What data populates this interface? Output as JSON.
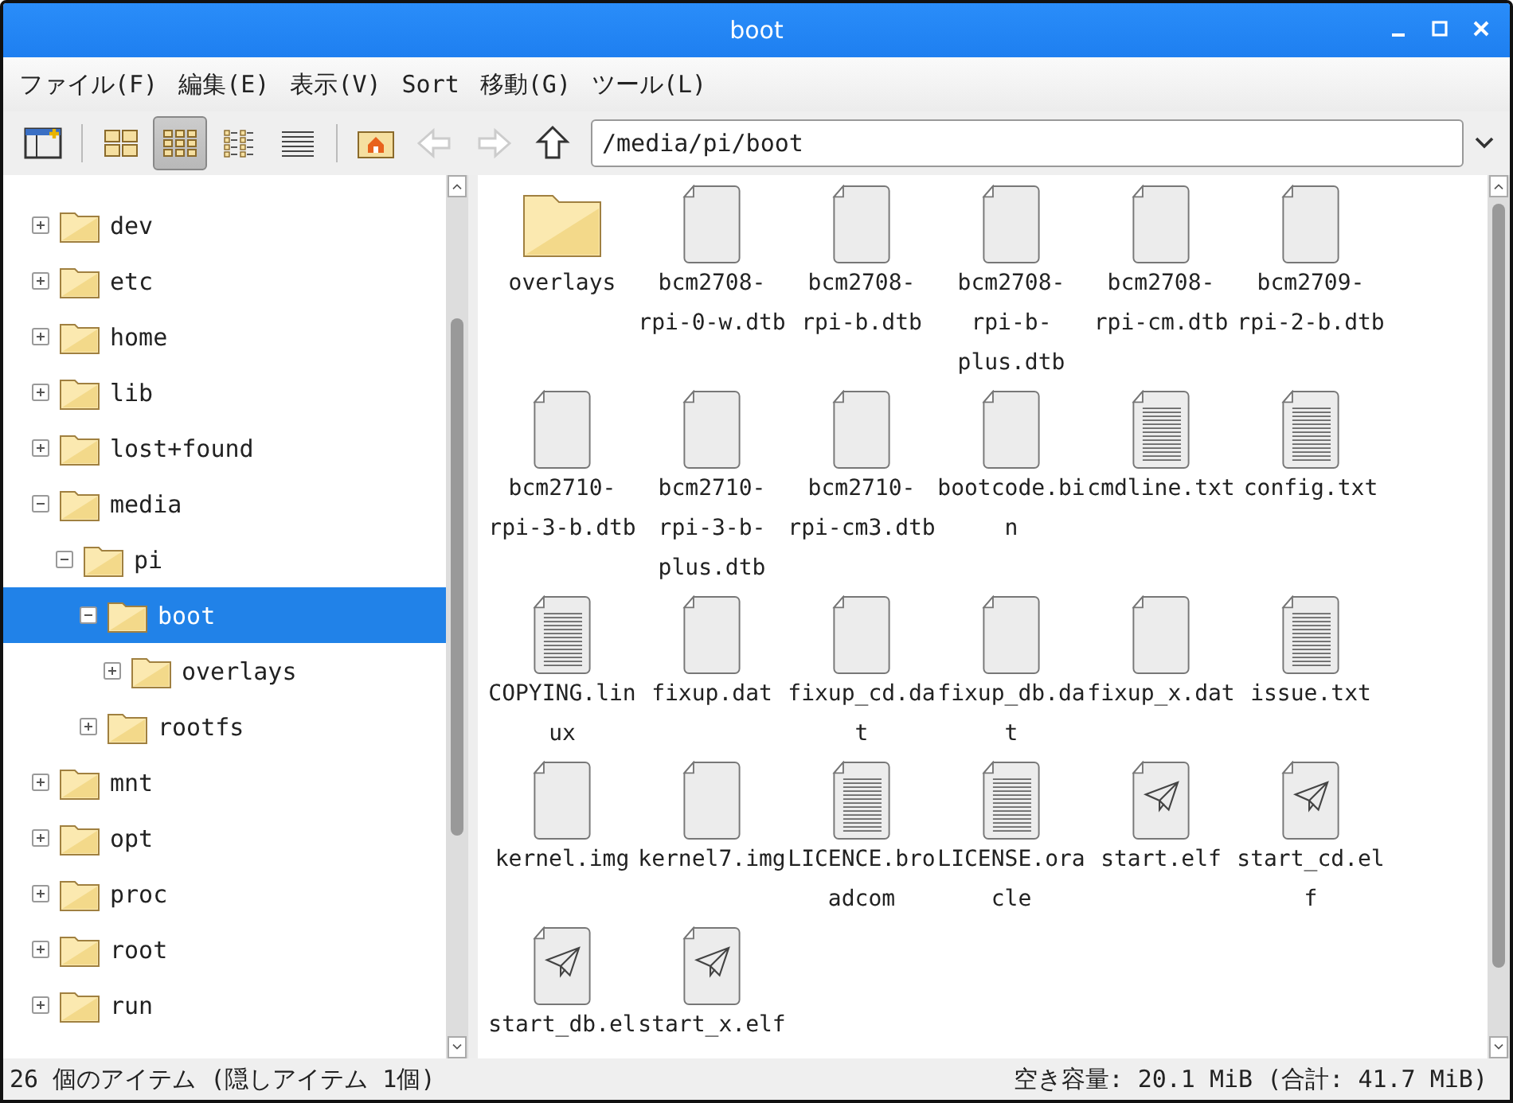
{
  "window": {
    "title": "boot"
  },
  "menu": [
    "ファイル(F)",
    "編集(E)",
    "表示(V)",
    "Sort",
    "移動(G)",
    "ツール(L)"
  ],
  "toolbar": {
    "views": [
      {
        "kind": "thumb",
        "selected": false
      },
      {
        "kind": "icons",
        "selected": true
      },
      {
        "kind": "compact",
        "selected": false
      },
      {
        "kind": "list",
        "selected": false
      }
    ],
    "back_disabled": true,
    "forward_disabled": true,
    "path": "/media/pi/boot"
  },
  "tree": [
    {
      "name": "dev",
      "expanded": false
    },
    {
      "name": "etc",
      "expanded": false
    },
    {
      "name": "home",
      "expanded": false
    },
    {
      "name": "lib",
      "expanded": false
    },
    {
      "name": "lost+found",
      "expanded": false
    },
    {
      "name": "media",
      "expanded": true,
      "children": [
        {
          "name": "pi",
          "expanded": true,
          "children": [
            {
              "name": "boot",
              "expanded": true,
              "selected": true,
              "children": [
                {
                  "name": "overlays",
                  "expanded": false
                }
              ]
            },
            {
              "name": "rootfs",
              "expanded": false
            }
          ]
        }
      ]
    },
    {
      "name": "mnt",
      "expanded": false
    },
    {
      "name": "opt",
      "expanded": false
    },
    {
      "name": "proc",
      "expanded": false
    },
    {
      "name": "root",
      "expanded": false
    },
    {
      "name": "run",
      "expanded": false
    }
  ],
  "files": [
    {
      "name": "overlays",
      "kind": "folder"
    },
    {
      "name": "bcm2708-rpi-0-w.dtb",
      "kind": "file"
    },
    {
      "name": "bcm2708-rpi-b.dtb",
      "kind": "file"
    },
    {
      "name": "bcm2708-rpi-b-plus.dtb",
      "kind": "file"
    },
    {
      "name": "bcm2708-rpi-cm.dtb",
      "kind": "file"
    },
    {
      "name": "bcm2709-rpi-2-b.dtb",
      "kind": "file"
    },
    {
      "name": "bcm2710-rpi-3-b.dtb",
      "kind": "file"
    },
    {
      "name": "bcm2710-rpi-3-b-plus.dtb",
      "kind": "file"
    },
    {
      "name": "bcm2710-rpi-cm3.dtb",
      "kind": "file"
    },
    {
      "name": "bootcode.bin",
      "kind": "file"
    },
    {
      "name": "cmdline.txt",
      "kind": "text"
    },
    {
      "name": "config.txt",
      "kind": "text"
    },
    {
      "name": "COPYING.linux",
      "kind": "text"
    },
    {
      "name": "fixup.dat",
      "kind": "file"
    },
    {
      "name": "fixup_cd.dat",
      "kind": "file"
    },
    {
      "name": "fixup_db.dat",
      "kind": "file"
    },
    {
      "name": "fixup_x.dat",
      "kind": "file"
    },
    {
      "name": "issue.txt",
      "kind": "text"
    },
    {
      "name": "kernel.img",
      "kind": "file"
    },
    {
      "name": "kernel7.img",
      "kind": "file"
    },
    {
      "name": "LICENCE.broadcom",
      "kind": "text"
    },
    {
      "name": "LICENSE.oracle",
      "kind": "text"
    },
    {
      "name": "start.elf",
      "kind": "exec"
    },
    {
      "name": "start_cd.elf",
      "kind": "exec"
    },
    {
      "name": "start_db.el",
      "kind": "exec"
    },
    {
      "name": "start_x.elf",
      "kind": "exec"
    }
  ],
  "status_bar": {
    "left": "26 個のアイテム (隠しアイテム 1個)",
    "right": "空き容量: 20.1 MiB (合計: 41.7 MiB)"
  }
}
